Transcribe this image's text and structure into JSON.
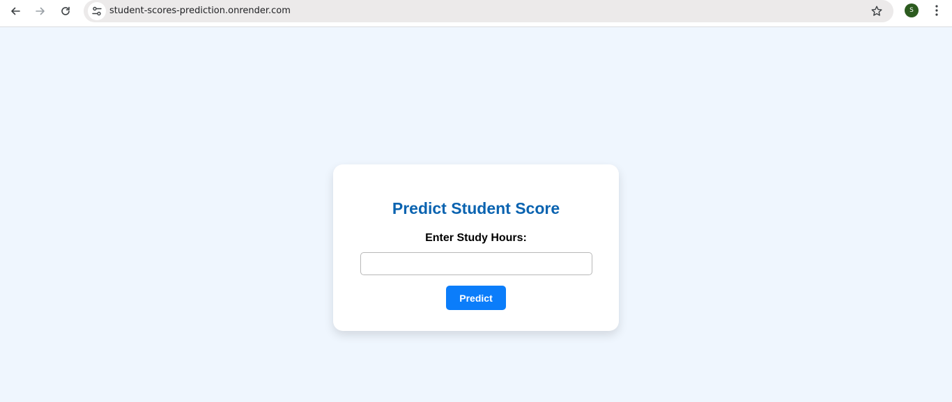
{
  "browser": {
    "url": "student-scores-prediction.onrender.com",
    "profile_initial": "S",
    "icons": {
      "back": "arrow-left-icon",
      "forward": "arrow-right-icon",
      "reload": "reload-icon",
      "site_info": "tune-icon",
      "bookmark": "star-icon",
      "menu": "kebab-menu-icon"
    }
  },
  "card": {
    "title": "Predict Student Score",
    "label": "Enter Study Hours:",
    "input_value": "",
    "button_label": "Predict"
  },
  "colors": {
    "page_background": "#eff6fe",
    "title": "#0a63b0",
    "button": "#0b7dfa",
    "avatar": "#2c5b1f"
  }
}
